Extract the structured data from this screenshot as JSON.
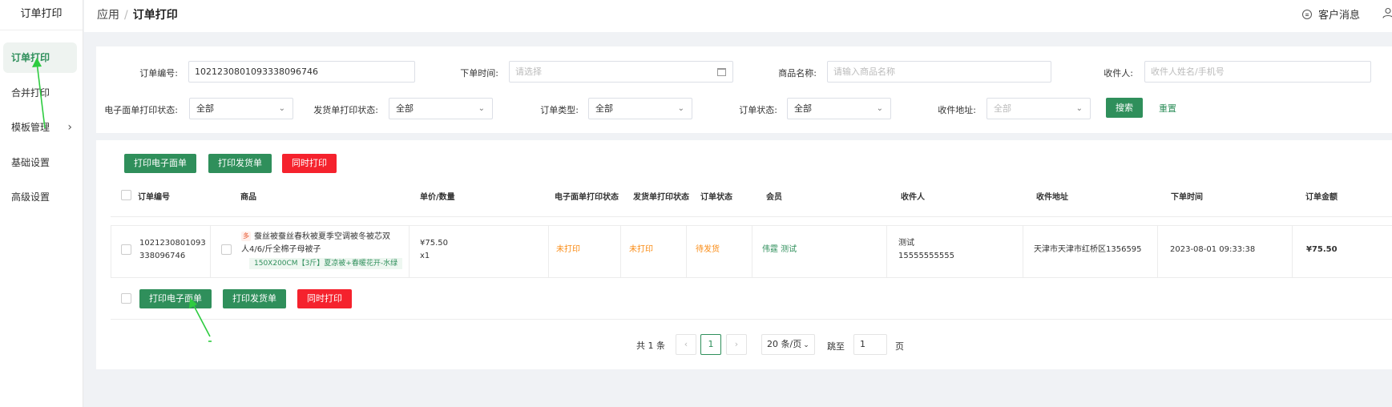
{
  "sidebar": {
    "title": "订单打印",
    "items": [
      {
        "label": "订单打印"
      },
      {
        "label": "合并打印"
      },
      {
        "label": "模板管理"
      },
      {
        "label": "基础设置"
      },
      {
        "label": "高级设置"
      }
    ]
  },
  "header": {
    "breadcrumb_root": "应用",
    "breadcrumb_sep": "/",
    "breadcrumb_current": "订单打印",
    "message_label": "客户消息"
  },
  "filters": {
    "order_no_label": "订单编号:",
    "order_no_value": "1021230801093338096746",
    "order_time_label": "下单时间:",
    "order_time_placeholder": "请选择",
    "product_label": "商品名称:",
    "product_placeholder": "请输入商品名称",
    "receiver_label": "收件人:",
    "receiver_placeholder": "收件人姓名/手机号",
    "ewaybill_status_label": "电子面单打印状态:",
    "ewaybill_status_value": "全部",
    "ship_status_label": "发货单打印状态:",
    "ship_status_value": "全部",
    "order_type_label": "订单类型:",
    "order_type_value": "全部",
    "order_status_label": "订单状态:",
    "order_status_value": "全部",
    "address_label": "收件地址:",
    "address_value": "全部",
    "search_label": "搜索",
    "reset_label": "重置"
  },
  "actions": {
    "print_ewaybill": "打印电子面单",
    "print_shipping": "打印发货单",
    "print_both": "同时打印"
  },
  "table": {
    "columns": [
      "订单编号",
      "商品",
      "单价/数量",
      "电子面单打印状态",
      "发货单打印状态",
      "订单状态",
      "会员",
      "收件人",
      "收件地址",
      "下单时间",
      "订单金额"
    ],
    "rows": [
      {
        "order_no_line1": "1021230801093",
        "order_no_line2": "338096746",
        "tag": "多",
        "product_line1": "蚕丝被蚕丝春秋被夏季空调被冬被芯双",
        "product_line2": "人4/6/斤全棉子母被子",
        "sku": "150X200CM【3斤】夏凉被+春暖花开-水绿",
        "price": "¥75.50",
        "qty": "x1",
        "ewaybill_status": "未打印",
        "ship_status": "未打印",
        "order_status": "待发货",
        "member": "伟霆 测试",
        "receiver_name": "测试",
        "receiver_phone": "15555555555",
        "address": "天津市天津市红桥区1356595",
        "order_time": "2023-08-01 09:33:38",
        "amount": "¥75.50"
      }
    ]
  },
  "pagination": {
    "total": "共 1 条",
    "prev": "‹",
    "page": "1",
    "next": "›",
    "page_size": "20 条/页",
    "jump_label": "跳至",
    "jump_value": "1",
    "page_suffix": "页"
  },
  "colors": {
    "accent": "#2f8f5b",
    "danger": "#f5222d",
    "warning": "#fa8c16",
    "annotation": "#2ecc40"
  }
}
